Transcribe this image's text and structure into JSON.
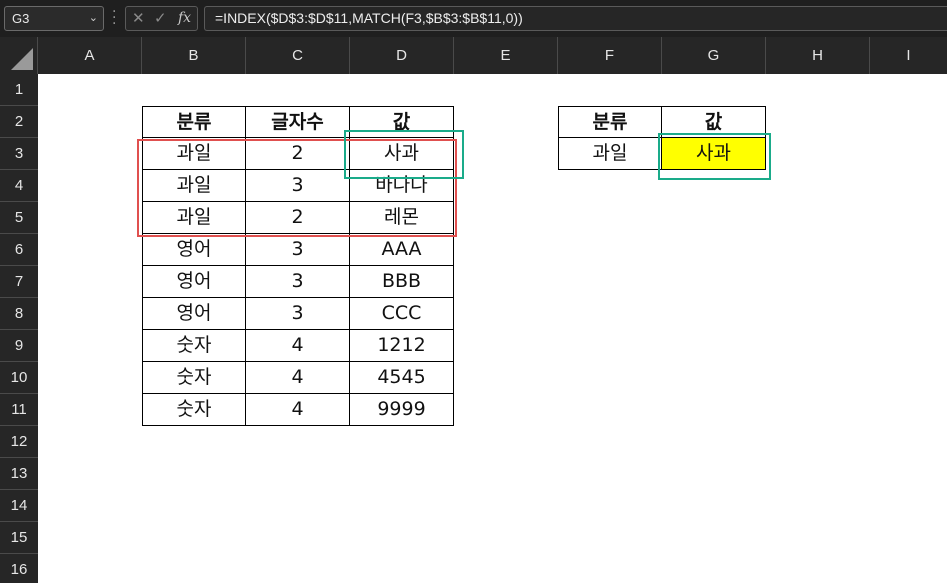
{
  "name_box": {
    "value": "G3"
  },
  "formula_bar": {
    "fx_label": "fx",
    "formula": "=INDEX($D$3:$D$11,MATCH(F3,$B$3:$B$11,0))"
  },
  "columns": [
    "A",
    "B",
    "C",
    "D",
    "E",
    "F",
    "G",
    "H",
    "I"
  ],
  "rows": [
    "1",
    "2",
    "3",
    "4",
    "5",
    "6",
    "7",
    "8",
    "9",
    "10",
    "11",
    "12",
    "13",
    "14",
    "15",
    "16"
  ],
  "left_table": {
    "headers": [
      "분류",
      "글자수",
      "값"
    ],
    "rows": [
      [
        "과일",
        "2",
        "사과"
      ],
      [
        "과일",
        "3",
        "바나나"
      ],
      [
        "과일",
        "2",
        "레몬"
      ],
      [
        "영어",
        "3",
        "AAA"
      ],
      [
        "영어",
        "3",
        "BBB"
      ],
      [
        "영어",
        "3",
        "CCC"
      ],
      [
        "숫자",
        "4",
        "1212"
      ],
      [
        "숫자",
        "4",
        "4545"
      ],
      [
        "숫자",
        "4",
        "9999"
      ]
    ]
  },
  "right_table": {
    "headers": [
      "분류",
      "값"
    ],
    "row": [
      "과일",
      "사과"
    ],
    "result_fill": "#ffff00"
  },
  "annotations": {
    "red_box_color": "#e0504f",
    "teal_box_color": "#1aab8a"
  }
}
